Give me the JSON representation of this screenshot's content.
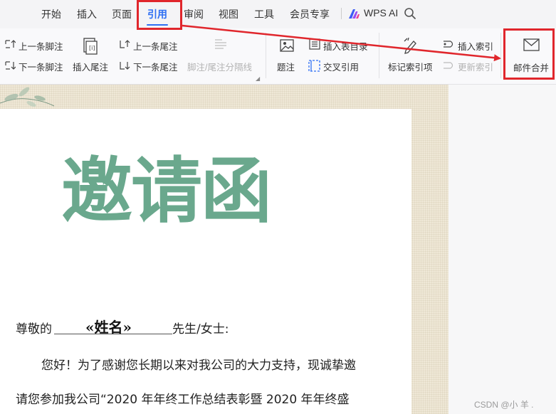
{
  "menu": {
    "items": [
      "开始",
      "插入",
      "页面",
      "引用",
      "审阅",
      "视图",
      "工具",
      "会员专享"
    ],
    "active": "引用",
    "wps_ai_label": "WPS AI"
  },
  "ribbon": {
    "prev_footnote": "上一条脚注",
    "next_footnote": "下一条脚注",
    "insert_endnote": "插入尾注",
    "prev_endnote": "上一条尾注",
    "next_endnote": "下一条尾注",
    "footnote_separator": "脚注/尾注分隔线",
    "caption": "题注",
    "insert_table_of_figures": "插入表目录",
    "cross_reference": "交叉引用",
    "mark_index_entry": "标记索引项",
    "insert_index": "插入索引",
    "update_index": "更新索引",
    "mail_merge": "邮件合并"
  },
  "document": {
    "title": "邀请函",
    "greeting_prefix": "尊敬的",
    "name_field": "«姓名»",
    "greeting_suffix": "先生/女士:",
    "line1": "您好！为了感谢您长期以来对我公司的大力支持，现诚挚邀",
    "line2": "请您参加我公司“2020 年年终工作总结表彰暨 2020 年年终盛"
  },
  "watermark": "CSDN @小 羊 .",
  "colors": {
    "accent": "#2f6ff3",
    "annotation_red": "#e0262c",
    "title_green": "#6aa88d"
  }
}
